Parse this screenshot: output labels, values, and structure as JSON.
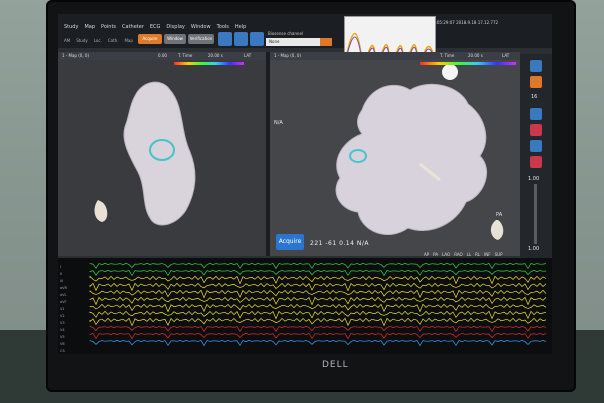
{
  "scene": {
    "monitor_brand": "DELL"
  },
  "app": {
    "menu": [
      "Study",
      "Map",
      "Points",
      "Catheter",
      "ECG",
      "Display",
      "Window",
      "Tools",
      "Help"
    ],
    "submenu": [
      "AM",
      "Study",
      "Loc.",
      "Cath.",
      "Map"
    ],
    "toolbar_buttons": [
      {
        "label": "Acquire",
        "color": "#e07a2b"
      },
      {
        "label": "Window",
        "color": "#6f7377"
      },
      {
        "label": "Verification",
        "color": "#6f7377"
      }
    ],
    "field_label": "Biosense channel",
    "field_value": "None",
    "status_text": "Time: 10:05:29:07  2018.9.18  17.12.772"
  },
  "left_pane": {
    "header": "1 - Map (0, 0)",
    "time_label": "T. Time",
    "time_value": "20.00 s",
    "lat_label": "LAT",
    "scale_value": "0.00"
  },
  "right_pane": {
    "header": "1 - Map (0, 0)",
    "time_label": "T. Time",
    "time_value": "20.00 s",
    "lat_label": "LAT",
    "view_tag": "PA",
    "na_label": "N/A",
    "acquire_label": "Acquire",
    "readout": "221  -61  0.14  N/A",
    "orientation_labels": [
      "AP",
      "PA",
      "LAO",
      "RAO",
      "LL",
      "RL",
      "INF",
      "SUP"
    ],
    "zoom_value": "16",
    "scale_top": "1.00",
    "scale_bottom": "1.00"
  },
  "ecg": {
    "lead_labels": [
      "I",
      "II",
      "III",
      "aVR",
      "aVL",
      "aVF",
      "V1",
      "V2",
      "V3",
      "V4",
      "V5",
      "V6",
      "CS"
    ],
    "colors": [
      "#37d53e",
      "#f0e020",
      "#e03030",
      "#3aa0ff"
    ]
  }
}
